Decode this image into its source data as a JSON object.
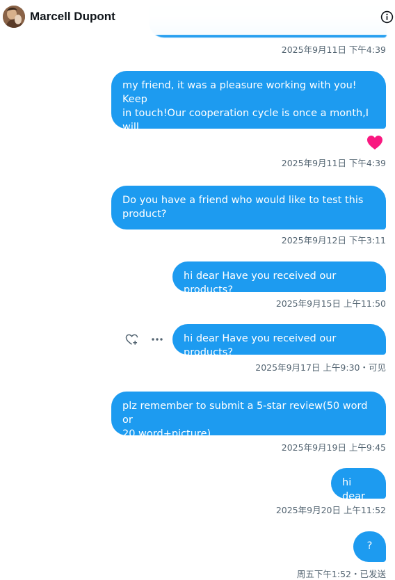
{
  "header": {
    "contact_name": "Marcell Dupont",
    "info_icon": "info-icon"
  },
  "messages": [
    {
      "text": "",
      "time": "2025年9月11日 下午4:39"
    },
    {
      "text": "my friend, it was a pleasure working with you! Keep\nin touch!Our cooperation cycle is once a month,I will\nprovide you with new toys!!",
      "time": "2025年9月11日 下午4:39",
      "reaction": "heart-icon"
    },
    {
      "text": "Do you have a friend who would like to test this\nproduct?",
      "time": "2025年9月12日 下午3:11"
    },
    {
      "text": "hi dear Have you received our products?",
      "time": "2025年9月15日 上午11:50"
    },
    {
      "text": "hi dear Have you received our products?",
      "time": "2025年9月17日 上午9:30・可见",
      "actions": [
        "add-reaction-icon",
        "more-icon"
      ]
    },
    {
      "text": "plz remember to submit a 5-star review(50 word or\n20 word+picture)",
      "time": "2025年9月19日 上午9:45"
    },
    {
      "text": "hi dear",
      "time": "2025年9月20日 上午11:52"
    },
    {
      "text": "?",
      "time": "周五下午1:52・已发送"
    }
  ],
  "colors": {
    "bubble": "#1d9bf0",
    "bubble_text": "#ffffff",
    "meta_text": "#536471",
    "heart": "#f91880"
  }
}
